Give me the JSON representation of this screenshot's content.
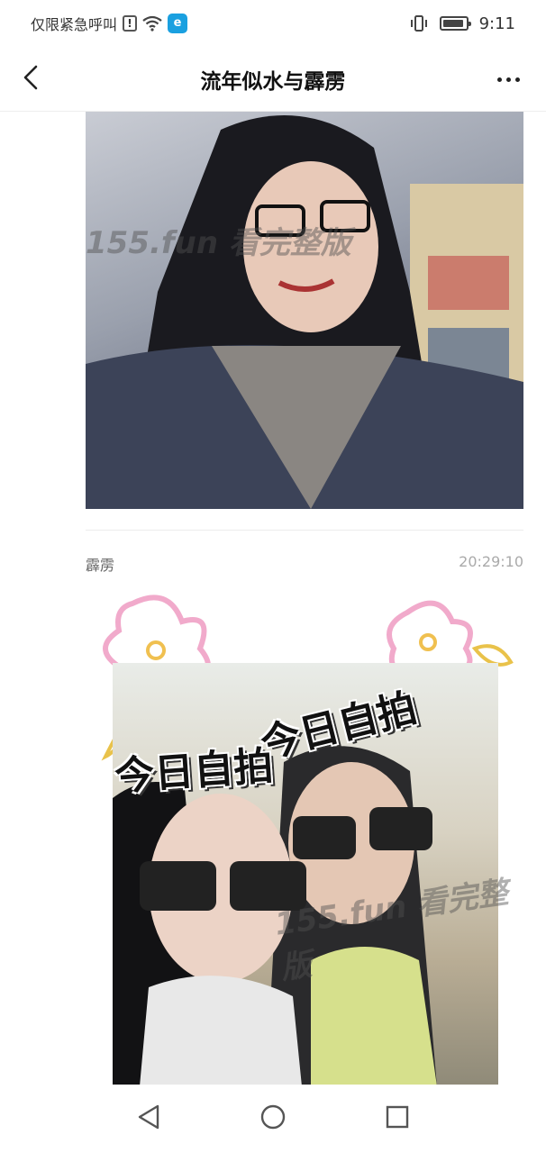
{
  "status_bar": {
    "carrier_text": "仅限紧急呼叫",
    "alert_glyph": "!",
    "app_glyph": "e",
    "time": "9:11"
  },
  "header": {
    "title": "流年似水与霹雳",
    "icons": {
      "back": "chevron-left-icon",
      "more": "more-horizontal-icon"
    }
  },
  "messages": [
    {
      "type": "image",
      "description_icon": "photo-selfie",
      "watermark": "155.fun 看完整版"
    },
    {
      "sender": "霹雳",
      "time": "20:29:10",
      "type": "image",
      "sticker_texts": [
        "今日自拍",
        "今日自拍"
      ],
      "watermark": "155.fun 看完整版"
    }
  ],
  "nav_keys": {
    "back": "triangle-back-icon",
    "home": "circle-home-icon",
    "recents": "square-recents-icon"
  },
  "colors": {
    "app_badge": "#1aa0e0",
    "time_text": "#aaaaaa",
    "divider": "#ececec"
  }
}
